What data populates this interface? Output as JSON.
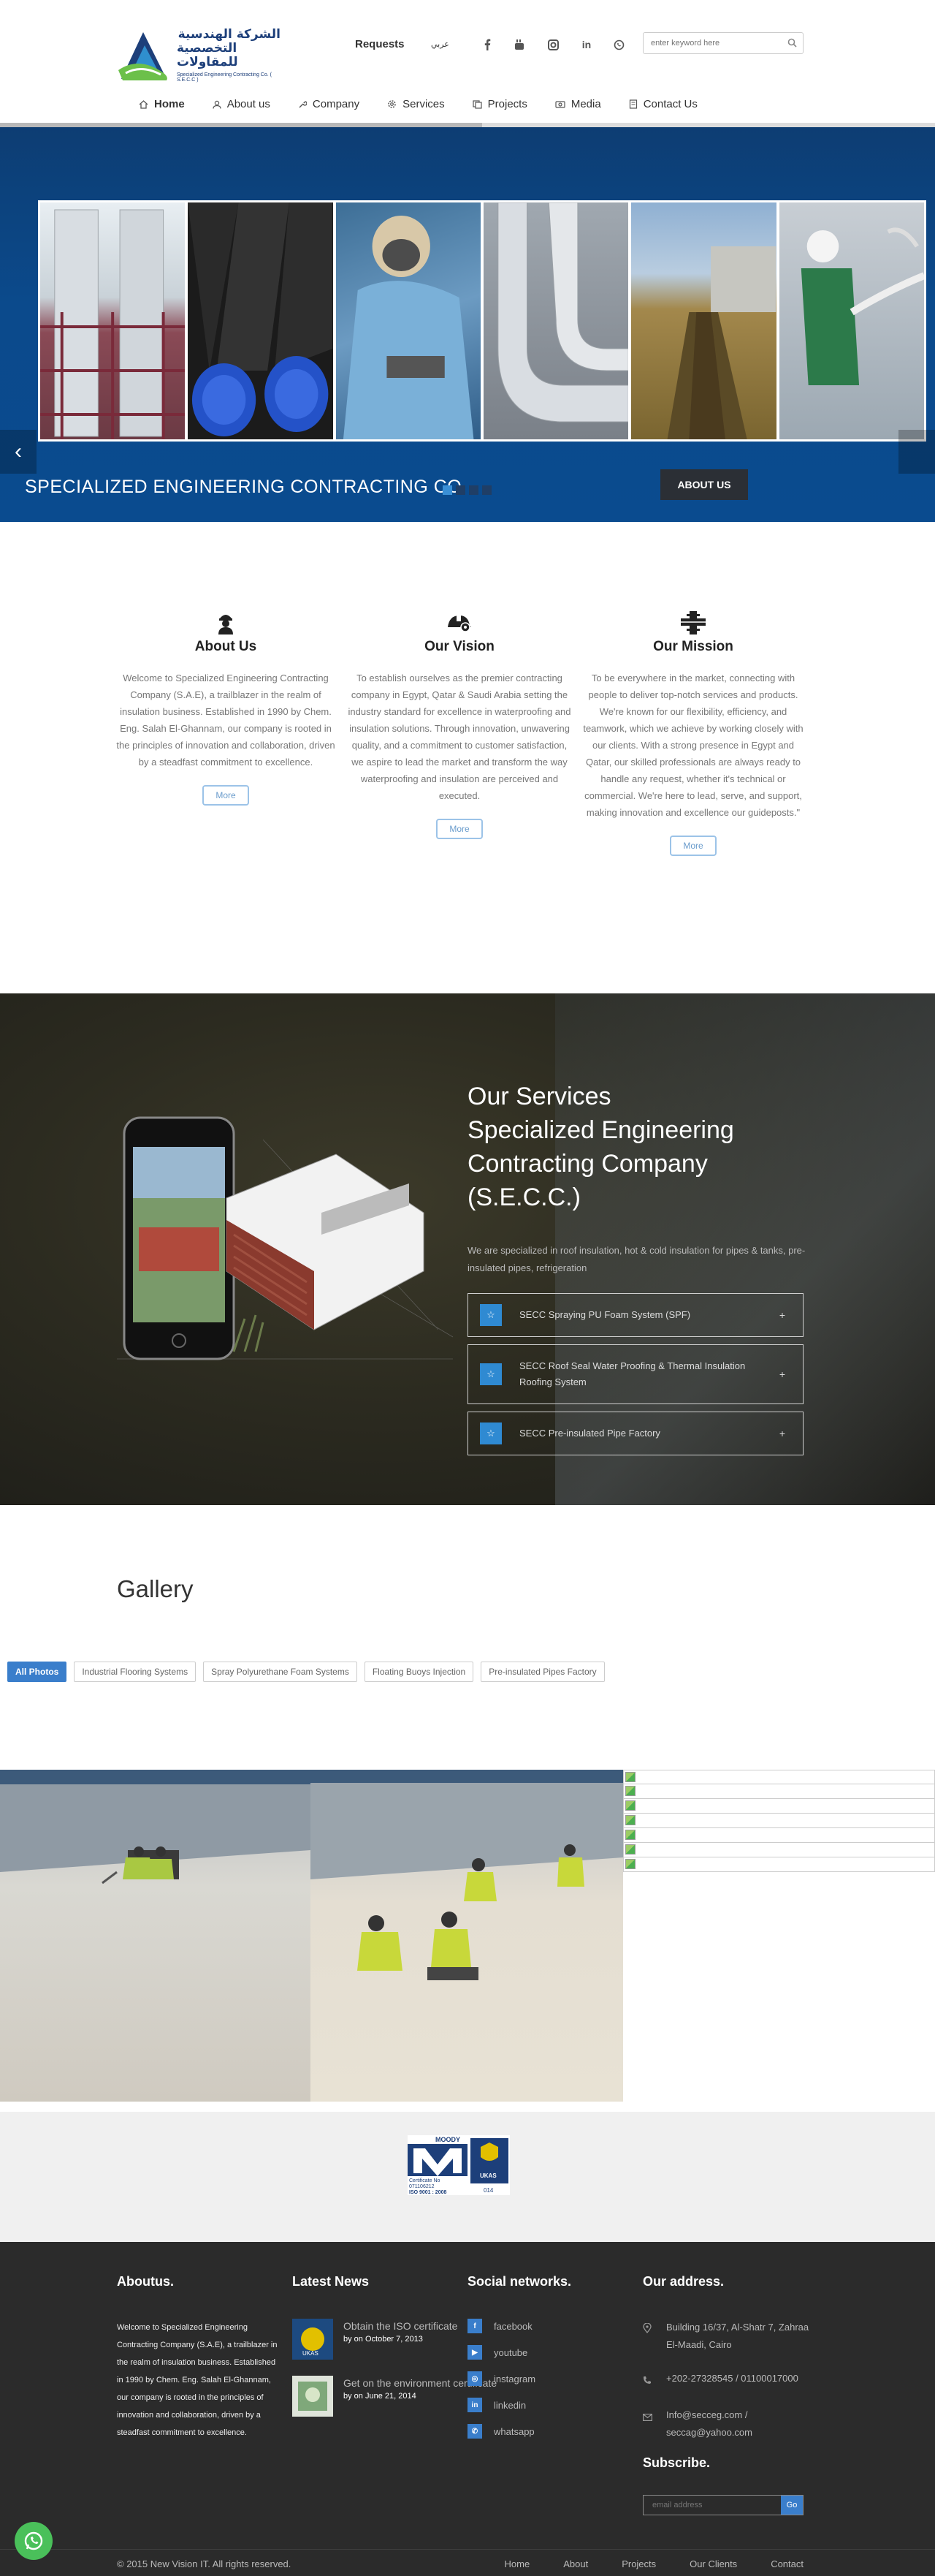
{
  "header": {
    "logo_ar_line1": "الشركة الهندسية",
    "logo_ar_line2": "التخصصية للمقاولات",
    "logo_en": "Specialized Engineering Contracting Co. ( S.E.C.C )",
    "requests": "Requests",
    "arabic": "عربي",
    "search_placeholder": "enter keyword here",
    "social_icons": [
      "facebook-icon",
      "youtube-icon",
      "instagram-icon",
      "linkedin-icon",
      "whatsapp-icon"
    ]
  },
  "nav": {
    "items": [
      {
        "label": "Home",
        "icon": "home-icon"
      },
      {
        "label": "About us",
        "icon": "user-icon"
      },
      {
        "label": "Company",
        "icon": "wrench-icon"
      },
      {
        "label": "Services",
        "icon": "gear-icon"
      },
      {
        "label": "Projects",
        "icon": "files-icon"
      },
      {
        "label": "Media",
        "icon": "camera-icon"
      },
      {
        "label": "Contact Us",
        "icon": "document-icon"
      }
    ]
  },
  "hero": {
    "title": "SPECIALIZED ENGINEERING CONTRACTING CO.",
    "button": "ABOUT US",
    "prev": "‹",
    "slide_count": 4,
    "active_slide": 1
  },
  "about": {
    "columns": [
      {
        "title": "About Us",
        "icon": "worker-icon",
        "text": "Welcome to Specialized Engineering Contracting Company (S.A.E), a trailblazer in the realm of insulation business. Established in 1990 by Chem. Eng. Salah El-Ghannam, our company is rooted in the principles of innovation and collaboration, driven by a steadfast commitment to excellence.",
        "more": "More"
      },
      {
        "title": "Our Vision",
        "icon": "helmet-icon",
        "text": "To establish ourselves as the premier contracting company in Egypt, Qatar & Saudi Arabia setting the industry standard for excellence in waterproofing and insulation solutions. Through innovation, unwavering quality, and a commitment to customer satisfaction, we aspire to lead the market and transform the way waterproofing and insulation are perceived and executed.",
        "more": "More"
      },
      {
        "title": "Our Mission",
        "icon": "pipes-icon",
        "text": "To be everywhere in the market, connecting with people to deliver top-notch services and products. We're known for our flexibility, efficiency, and teamwork, which we achieve by working closely with our clients. With a strong presence in Egypt and Qatar, our skilled professionals are always ready to handle any request, whether it's technical or commercial. We're here to lead, serve, and support, making innovation and excellence our guideposts.\"",
        "more": "More"
      }
    ]
  },
  "services": {
    "title_line1": "Our Services",
    "title_line2": "Specialized Engineering",
    "title_line3": "Contracting Company",
    "title_line4": "(S.E.C.C.)",
    "subtitle": "We are specialized in roof insulation, hot & cold insulation for pipes & tanks, pre-insulated pipes, refrigeration",
    "accordion": [
      {
        "label": "SECC Spraying PU Foam System (SPF)"
      },
      {
        "label": "SECC Roof Seal Water Proofing & Thermal Insulation Roofing System"
      },
      {
        "label": "SECC Pre-insulated Pipe Factory"
      }
    ]
  },
  "gallery": {
    "title": "Gallery",
    "filters": [
      "All Photos",
      "Industrial Flooring Systems",
      "Spray Polyurethane Foam Systems",
      "Floating Buoys Injection",
      "Pre-insulated Pipes Factory"
    ],
    "active_filter": "All Photos"
  },
  "certificate": {
    "brand": "MOODY",
    "cert_no": "Certificate No",
    "number": "071106212",
    "standard": "ISO 9001 : 2008",
    "ukas": "UKAS",
    "ukas_code": "014"
  },
  "footer": {
    "about_title": "Aboutus.",
    "about_text": "Welcome to Specialized Engineering Contracting Company (S.A.E), a trailblazer in the realm of insulation business. Established in 1990 by Chem. Eng. Salah El-Ghannam, our company is rooted in the principles of innovation and collaboration, driven by a steadfast commitment to excellence.",
    "news_title": "Latest News",
    "news": [
      {
        "title": "Obtain the ISO certificate",
        "date": "by on October 7, 2013"
      },
      {
        "title": "Get on the environment certificate",
        "date": "by on June 21, 2014"
      }
    ],
    "social_title": "Social networks.",
    "social": [
      {
        "label": "facebook",
        "glyph": "f"
      },
      {
        "label": "youtube",
        "glyph": "▶"
      },
      {
        "label": "instagram",
        "glyph": "◎"
      },
      {
        "label": "linkedin",
        "glyph": "in"
      },
      {
        "label": "whatsapp",
        "glyph": "✆"
      }
    ],
    "address_title": "Our address.",
    "address": "Building 16/37, Al-Shatr 7, Zahraa El-Maadi, Cairo",
    "phone": "+202-27328545 / 01100017000",
    "email": "Info@secceg.com / seccag@yahoo.com",
    "subscribe_title": "Subscribe.",
    "subscribe_placeholder": "email address",
    "go": "Go",
    "copyright": "© 2015 New Vision IT. All rights reserved.",
    "links": [
      "Home",
      "About",
      "Projects",
      "Our Clients",
      "Contact"
    ]
  },
  "colors": {
    "accent": "#3a7ecb",
    "hero_blue": "#0b4a8c",
    "footer": "#2b2b2b",
    "whatsapp": "#4ac05a"
  }
}
